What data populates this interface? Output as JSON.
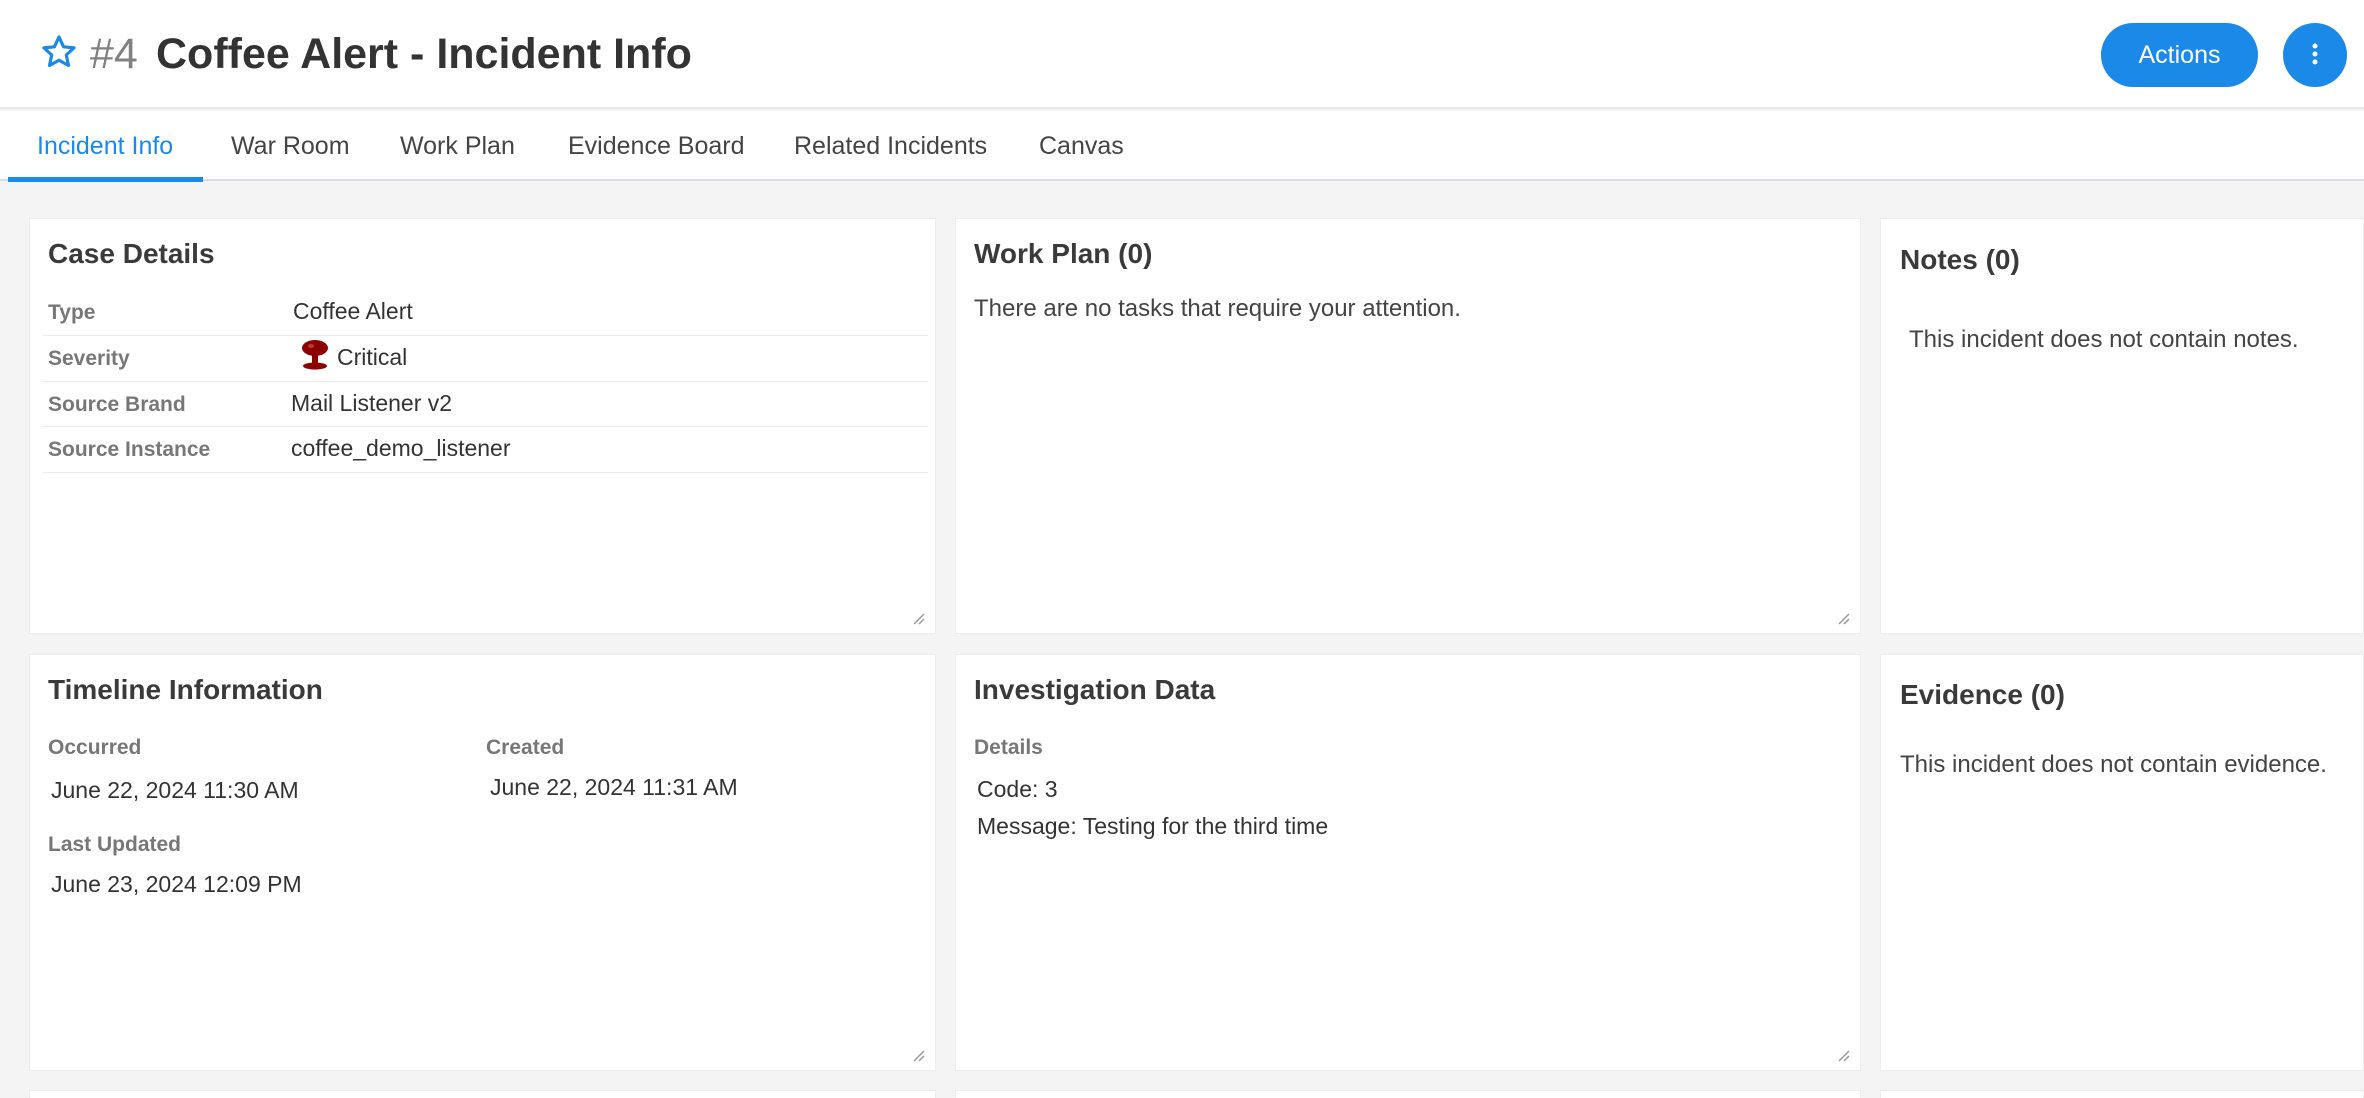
{
  "header": {
    "incident_number": "#4",
    "incident_title": "Coffee Alert - Incident Info",
    "actions_label": "Actions"
  },
  "tabs": [
    {
      "label": "Incident Info",
      "active": true
    },
    {
      "label": "War Room"
    },
    {
      "label": "Work Plan"
    },
    {
      "label": "Evidence Board"
    },
    {
      "label": "Related Incidents"
    },
    {
      "label": "Canvas"
    }
  ],
  "case_details": {
    "title": "Case Details",
    "rows": [
      {
        "label": "Type",
        "value": "Coffee Alert"
      },
      {
        "label": "Severity",
        "value": "Critical"
      },
      {
        "label": "Source Brand",
        "value": "Mail Listener v2"
      },
      {
        "label": "Source Instance",
        "value": "coffee_demo_listener"
      }
    ],
    "severity_color": "#8b0000"
  },
  "work_plan": {
    "title": "Work Plan (0)",
    "empty_text": "There are no tasks that require your attention."
  },
  "notes": {
    "title": "Notes (0)",
    "empty_text": "This incident does not contain notes."
  },
  "timeline": {
    "title": "Timeline Information",
    "occurred_label": "Occurred",
    "occurred_value": "June 22, 2024 11:30 AM",
    "created_label": "Created",
    "created_value": "June 22, 2024 11:31 AM",
    "updated_label": "Last Updated",
    "updated_value": "June 23, 2024 12:09 PM"
  },
  "investigation": {
    "title": "Investigation Data",
    "details_label": "Details",
    "code_line": "Code: 3",
    "message_line": "Message: Testing for the third time"
  },
  "evidence": {
    "title": "Evidence (0)",
    "empty_text": "This incident does not contain evidence."
  },
  "colors": {
    "accent": "#1a89e8",
    "background": "#f4f4f4"
  }
}
